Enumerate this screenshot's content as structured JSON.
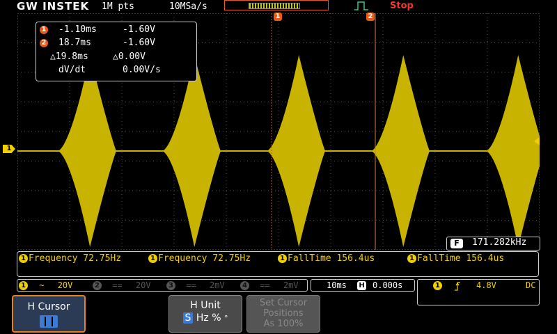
{
  "header": {
    "brand": "GW INSTEK",
    "record_length": "1M pts",
    "sample_rate": "10MSa/s",
    "run_status": "Stop"
  },
  "cursors": {
    "marker1": "1",
    "marker2": "2",
    "readout": {
      "row1": {
        "num": "1",
        "time": "-1.10ms",
        "volt": "-1.60V"
      },
      "row2": {
        "num": "2",
        "time": "18.7ms",
        "volt": "-1.60V"
      },
      "delta": {
        "time": "△19.8ms",
        "volt": "△0.00V"
      },
      "slope": {
        "label": "dV/dt",
        "value": "0.00V/s"
      }
    }
  },
  "channel1_marker": "1",
  "frequency_counter": {
    "badge": "F",
    "value": "171.282kHz"
  },
  "measurements": [
    {
      "ch": "1",
      "text": "Frequency 72.75Hz"
    },
    {
      "ch": "1",
      "text": "Frequency 72.75Hz"
    },
    {
      "ch": "1",
      "text": "FallTime 156.4us"
    },
    {
      "ch": "1",
      "text": "FallTime 156.4us"
    }
  ],
  "channels": [
    {
      "num": "1",
      "coupling": "~",
      "scale": "20V",
      "active": true
    },
    {
      "num": "2",
      "coupling": "==",
      "scale": "20V",
      "active": false
    },
    {
      "num": "3",
      "coupling": "==",
      "scale": "2mV",
      "active": false
    },
    {
      "num": "4",
      "coupling": "==",
      "scale": "2mV",
      "active": false
    }
  ],
  "timebase": {
    "scale": "10ms",
    "h_badge": "H",
    "position": "0.000s"
  },
  "trigger": {
    "source": "1",
    "level": "4.8V",
    "coupling": "DC"
  },
  "softkeys": {
    "h_cursor": "H Cursor",
    "h_unit": "H Unit",
    "h_unit_s": "S",
    "h_unit_hz": "Hz",
    "h_unit_pct": "%",
    "h_unit_deg": "°",
    "set_cursor": [
      "Set Cursor",
      "Positions",
      "As 100%"
    ]
  },
  "colors": {
    "ch1": "#c8b400",
    "cursor": "#e85a1a",
    "stop": "#f03a2a"
  }
}
